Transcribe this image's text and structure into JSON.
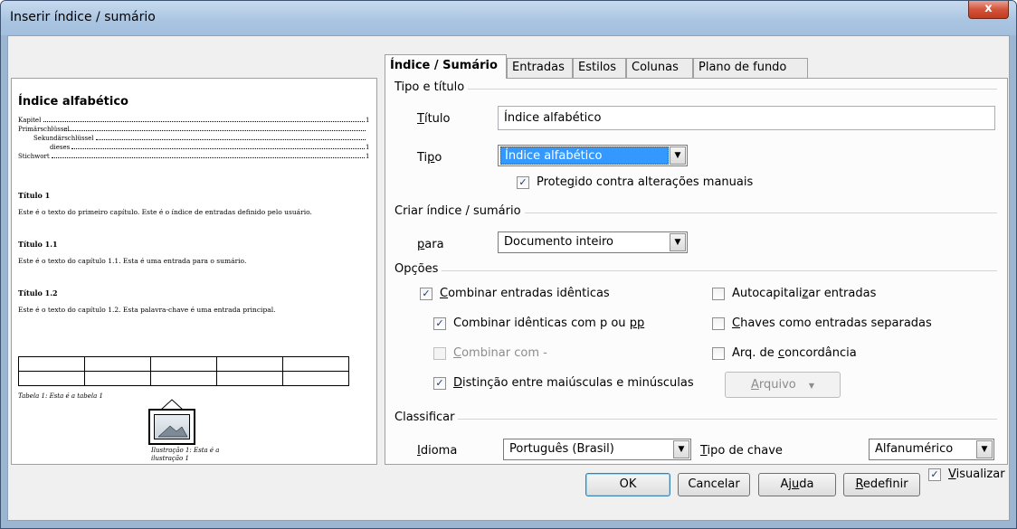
{
  "window": {
    "title": "Inserir índice / sumário",
    "close_label": "x"
  },
  "preview": {
    "heading": "Índice alfabético",
    "entries": [
      {
        "text": "Kapitel",
        "page": "1"
      },
      {
        "text": "Primärschlüssel",
        "page": ""
      },
      {
        "text": "Sekundärschlüssel",
        "page": ""
      },
      {
        "text": "dieses",
        "page": "1"
      },
      {
        "text": "Stichwort",
        "page": "1"
      }
    ],
    "sections": [
      {
        "title": "Título 1",
        "body": "Este é o texto do primeiro capítulo. Este é o índice de entradas definido pelo usuário."
      },
      {
        "title": "Título 1.1",
        "body": "Este é o texto do capítulo 1.1. Esta é uma entrada para o sumário."
      },
      {
        "title": "Título 1.2",
        "body": "Este é o texto do capítulo 1.2. Esta palavra-chave é uma entrada principal."
      }
    ],
    "table_caption": "Tabela 1: Esta é a tabela 1",
    "illustration_caption_1": "Ilustração 1: Esta é a",
    "illustration_caption_2": "ilustração 1"
  },
  "tabs": [
    "Índice / Sumário",
    "Entradas",
    "Estilos",
    "Colunas",
    "Plano de fundo"
  ],
  "active_tab": 0,
  "type_title": {
    "group_label": "Tipo e título",
    "title_label_u": "T",
    "title_label_rest": "ítulo",
    "title_value": "Índice alfabético",
    "type_label_pre": "Ti",
    "type_label_u": "p",
    "type_label_post": "o",
    "type_value": "Índice alfabético",
    "protected_label_pre": "Prote",
    "protected_label_u": "g",
    "protected_label_post": "ido contra alterações manuais",
    "protected_checked": true
  },
  "create_index": {
    "group_label": "Criar índice / sumário",
    "for_label_u": "p",
    "for_label_rest": "ara",
    "for_value": "Documento inteiro"
  },
  "options": {
    "group_label": "Opções",
    "combine_identical": {
      "u": "C",
      "rest": "ombinar entradas idênticas",
      "checked": true
    },
    "combine_p_pp": {
      "pre": "Combinar idênticas com p ou ",
      "u": "pp",
      "checked": true
    },
    "combine_with": {
      "u": "C",
      "rest": "ombinar com -",
      "checked": false,
      "disabled": true
    },
    "case_sensitive": {
      "u": "D",
      "rest": "istinção entre maiúsculas e minúsculas",
      "checked": true
    },
    "autocapitalize": {
      "pre": "Autocapitali",
      "u": "z",
      "post": "ar entradas",
      "checked": false
    },
    "keys_separate": {
      "u": "C",
      "rest": "haves como entradas separadas",
      "checked": false
    },
    "concordance": {
      "pre": "Arq. de ",
      "u": "c",
      "post": "oncordância",
      "checked": false
    },
    "file_button": {
      "u": "A",
      "rest": "rquivo",
      "arrow": "▼"
    }
  },
  "sort": {
    "group_label": "Classificar",
    "language_label_u": "I",
    "language_label_rest": "dioma",
    "language_value": "Português (Brasil)",
    "key_type_label_u": "T",
    "key_type_label_rest": "ipo de chave",
    "key_type_value": "Alfanumérico"
  },
  "buttons": {
    "ok": "OK",
    "cancel": "Cancelar",
    "help_pre": "Aj",
    "help_u": "u",
    "help_post": "da",
    "reset_u": "R",
    "reset_rest": "edefinir",
    "preview_u": "V",
    "preview_rest": "isualizar",
    "preview_checked": true
  },
  "icons": {
    "check": "✓",
    "dropdown": "▼"
  }
}
